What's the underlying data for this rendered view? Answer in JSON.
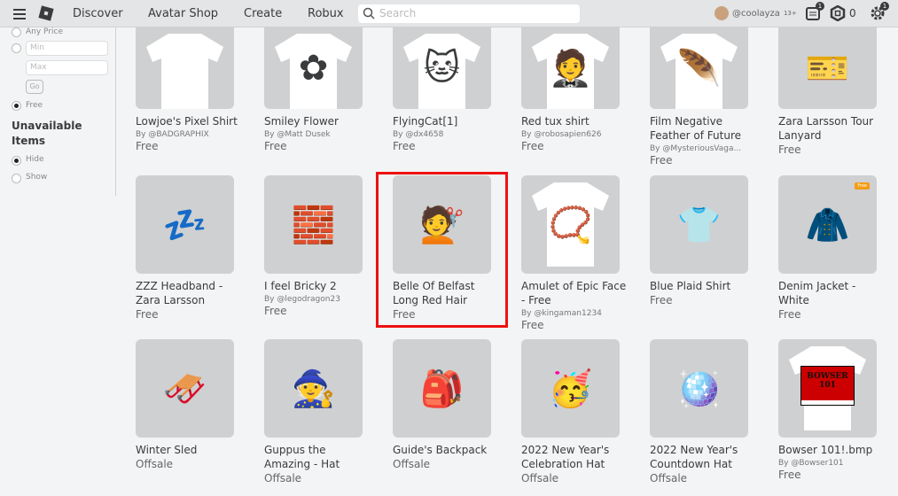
{
  "header": {
    "nav": [
      "Discover",
      "Avatar Shop",
      "Create",
      "Robux"
    ],
    "search_placeholder": "Search",
    "username": "@coolayza",
    "age_label": "13+",
    "notifications_badge": "1",
    "robux_balance": "0",
    "settings_badge": "1"
  },
  "sidebar": {
    "price_options": {
      "any": "Any Price",
      "min_placeholder": "Min",
      "max_placeholder": "Max",
      "go": "Go",
      "free": "Free"
    },
    "unavailable_title": "Unavailable Items",
    "unavailable_options": [
      "Hide",
      "Show"
    ]
  },
  "items": [
    {
      "name": "Lowjoe's Pixel Shirt",
      "creator": "By @BADGRAPHIX",
      "price": "Free",
      "kind": "shirt"
    },
    {
      "name": "Smiley Flower",
      "creator": "By @Matt Dusek",
      "price": "Free",
      "kind": "shirt",
      "art": "✿"
    },
    {
      "name": "FlyingCat[1]",
      "creator": "By @dx4658",
      "price": "Free",
      "kind": "shirt",
      "art": "🐱"
    },
    {
      "name": "Red tux shirt",
      "creator": "By @robosapien626",
      "price": "Free",
      "kind": "shirt",
      "art": "🤵"
    },
    {
      "name": "Film Negative Feather of Future",
      "creator": "By @MysteriousVaga...",
      "price": "Free",
      "kind": "shirt",
      "art": "🪶"
    },
    {
      "name": "Zara Larsson Tour Lanyard",
      "creator": "",
      "price": "Free",
      "kind": "item",
      "art": "🎫"
    },
    {
      "name": "ZZZ Headband - Zara Larsson",
      "creator": "",
      "price": "Free",
      "kind": "item",
      "art": "💤"
    },
    {
      "name": "I feel Bricky 2",
      "creator": "By @legodragon23",
      "price": "Free",
      "kind": "item",
      "art": "🧱"
    },
    {
      "name": "Belle Of Belfast Long Red Hair",
      "creator": "",
      "price": "Free",
      "kind": "item",
      "art": "💇"
    },
    {
      "name": "Amulet of Epic Face - Free",
      "creator": "By @kingaman1234",
      "price": "Free",
      "kind": "shirt",
      "art": "📿"
    },
    {
      "name": "Blue Plaid Shirt",
      "creator": "",
      "price": "Free",
      "kind": "item",
      "art": "👕"
    },
    {
      "name": "Denim Jacket - White",
      "creator": "",
      "price": "Free",
      "kind": "item",
      "art": "🧥",
      "tag": "Free"
    },
    {
      "name": "Winter Sled",
      "creator": "",
      "price": "Offsale",
      "kind": "item",
      "art": "🛷"
    },
    {
      "name": "Guppus the Amazing - Hat",
      "creator": "",
      "price": "Offsale",
      "kind": "item",
      "art": "🧙"
    },
    {
      "name": "Guide's Backpack",
      "creator": "",
      "price": "Offsale",
      "kind": "item",
      "art": "🎒"
    },
    {
      "name": "2022 New Year's Celebration Hat",
      "creator": "",
      "price": "Offsale",
      "kind": "item",
      "art": "🥳"
    },
    {
      "name": "2022 New Year's Countdown Hat",
      "creator": "",
      "price": "Offsale",
      "kind": "item",
      "art": "🪩"
    },
    {
      "name": "Bowser 101!.bmp",
      "creator": "By @Bowser101",
      "price": "Free",
      "kind": "shirt",
      "art": "BOWSER 101"
    }
  ],
  "colors": {
    "highlight": "#ee1111",
    "header_bg": "#e3e5e7",
    "thumb_bg": "#cfd0d1"
  }
}
